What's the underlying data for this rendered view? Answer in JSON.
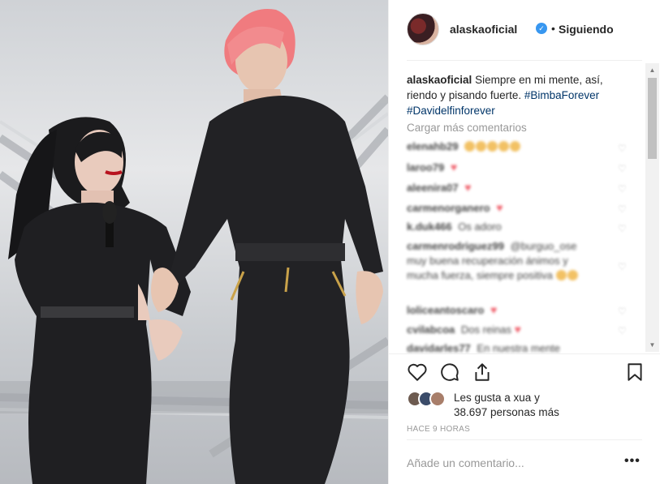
{
  "header": {
    "username": "alaskaoficial",
    "verified_icon": "verified-badge-icon",
    "separator": "•",
    "follow_status": "Siguiendo"
  },
  "caption": {
    "username": "alaskaoficial",
    "text": "Siempre en mi mente, así, riendo y pisando fuerte.",
    "hashtags": [
      "#BimbaForever",
      "#Davidelfinforever"
    ]
  },
  "load_more_comments": "Cargar más comentarios",
  "comments": [
    {
      "user": "elenahb29",
      "text": "",
      "emojis": 5,
      "heart": false
    },
    {
      "user": "laroo79",
      "text": "",
      "emojis": 0,
      "heart": true
    },
    {
      "user": "aleenira07",
      "text": "",
      "emojis": 0,
      "heart": true
    },
    {
      "user": "carmenorganero",
      "text": "",
      "emojis": 0,
      "heart": true
    },
    {
      "user": "k.duk466",
      "text": "Os adoro",
      "emojis": 0,
      "heart": false
    },
    {
      "user": "carmenrodriguez99",
      "text": "@burguo_ose muy buena recuperación ánimos y mucha fuerza, siempre positiva",
      "emojis": 2,
      "heart": false
    },
    {
      "user": "loliceantoscaro",
      "text": "",
      "emojis": 0,
      "heart": true
    },
    {
      "user": "cvilabcoa",
      "text": "Dos reinas",
      "emojis": 0,
      "heart": true
    },
    {
      "user": "davidarles77",
      "text": "En nuestra mente",
      "emojis": 0,
      "heart": false
    }
  ],
  "actions": {
    "like_icon": "heart-icon",
    "comment_icon": "comment-icon",
    "share_icon": "share-icon",
    "save_icon": "bookmark-icon"
  },
  "likes": {
    "line1": "Les gusta a xua y",
    "line2": "38.697 personas más"
  },
  "timestamp": "HACE 9 HORAS",
  "add_comment_placeholder": "Añade un comentario...",
  "more_options": "•••",
  "colors": {
    "hashtag": "#003569",
    "verified": "#3897f0",
    "heart": "#ed4956",
    "muted": "#999999",
    "text": "#262626"
  }
}
